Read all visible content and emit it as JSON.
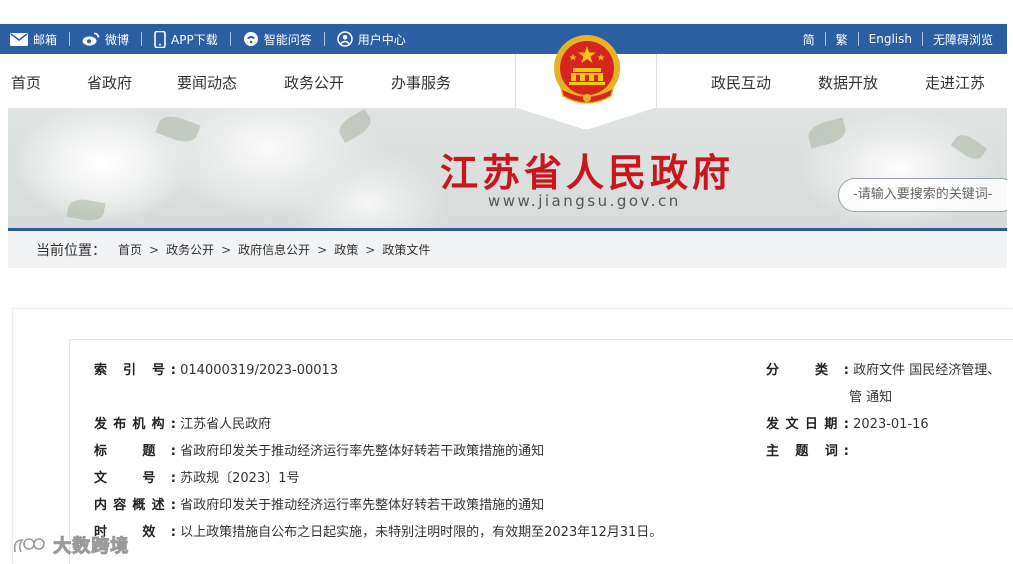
{
  "topbar": {
    "left": [
      {
        "label": "邮箱",
        "icon": "mail-icon"
      },
      {
        "label": "微博",
        "icon": "weibo-icon"
      },
      {
        "label": "APP下载",
        "icon": "phone-icon"
      },
      {
        "label": "智能问答",
        "icon": "chat-icon"
      },
      {
        "label": "用户中心",
        "icon": "user-icon"
      }
    ],
    "right": [
      "简",
      "繁",
      "English",
      "无障碍浏览"
    ]
  },
  "nav": {
    "items": [
      "首页",
      "省政府",
      "要闻动态",
      "政务公开",
      "办事服务",
      "政民互动",
      "数据开放",
      "走进江苏"
    ]
  },
  "banner": {
    "title": "江苏省人民政府",
    "url": "www.jiangsu.gov.cn",
    "search_placeholder": "-请输入要搜索的关键词-"
  },
  "breadcrumb": {
    "label": "当前位置：",
    "items": [
      "首页",
      "政务公开",
      "政府信息公开",
      "政策",
      "政策文件"
    ]
  },
  "meta": {
    "index_label": "索 引 号:",
    "index_value": "014000319/2023-00013",
    "category_label": "分 类:",
    "category_value_line1": "政府文件 国民经济管理、",
    "category_value_line2": "管 通知",
    "publisher_label": "发布机构:",
    "publisher_value": "江苏省人民政府",
    "date_label": "发文日期:",
    "date_value": "2023-01-16",
    "title_label": "标 题:",
    "title_value": "省政府印发关于推动经济运行率先整体好转若干政策措施的通知",
    "subject_label": "主 题 词:",
    "subject_value": "",
    "docno_label": "文 号:",
    "docno_value": "苏政规〔2023〕1号",
    "summary_label": "内容概述:",
    "summary_value": "省政府印发关于推动经济运行率先整体好转若干政策措施的通知",
    "validity_label": "时 效:",
    "validity_value": "以上政策措施自公布之日起实施，未特别注明时限的，有效期至2023年12月31日。"
  },
  "watermark": "大数跨境",
  "colors": {
    "brand_blue": "#2b5ea3",
    "title_red": "#c9161d"
  }
}
